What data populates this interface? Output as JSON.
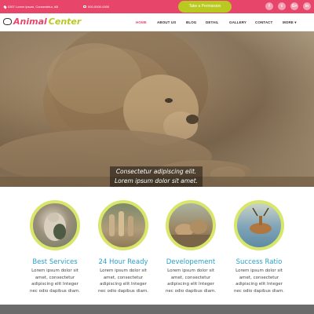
{
  "topbar": {
    "address": "0307 Lorem ipsum, Consectetur, AB",
    "phone": "000-0000-0000",
    "cta_label": "Take a Permission",
    "social": [
      "f",
      "t",
      "G+",
      "in"
    ]
  },
  "brand": {
    "word1": "Animal",
    "word2": "Center"
  },
  "nav": {
    "items": [
      "HOME",
      "ABOUT US",
      "BLOG",
      "DETAIL",
      "GALLERY",
      "CONTACT",
      "MORE ▾"
    ],
    "active_index": 0
  },
  "hero": {
    "caption_line1": "Consectetur adipiscing elit.",
    "caption_line2": "Lorem ipsum dolor sit amet."
  },
  "services": [
    {
      "title": "Best Services",
      "desc1": "Lorem ipsum dolor sit",
      "desc2": "amet, consectetur",
      "desc3": "adipiscing elit Integer",
      "desc4": "nec odio dapibus diam."
    },
    {
      "title": "24 Hour Ready",
      "desc1": "Lorem ipsum dolor sit",
      "desc2": "amet, consectetur",
      "desc3": "adipiscing elit Integer",
      "desc4": "nec odio dapibus diam."
    },
    {
      "title": "Developement",
      "desc1": "Lorem ipsum dolor sit",
      "desc2": "amet, consectetur",
      "desc3": "adipiscing elit Integer",
      "desc4": "nec odio dapibus diam."
    },
    {
      "title": "Success Ratio",
      "desc1": "Lorem ipsum dolor sit",
      "desc2": "amet, consectetur",
      "desc3": "adipiscing elit Integer",
      "desc4": "nec odio dapibus diam."
    }
  ],
  "colors": {
    "accent": "#e8456b",
    "lime": "#b9c91f",
    "title_blue": "#2aa0c8"
  }
}
